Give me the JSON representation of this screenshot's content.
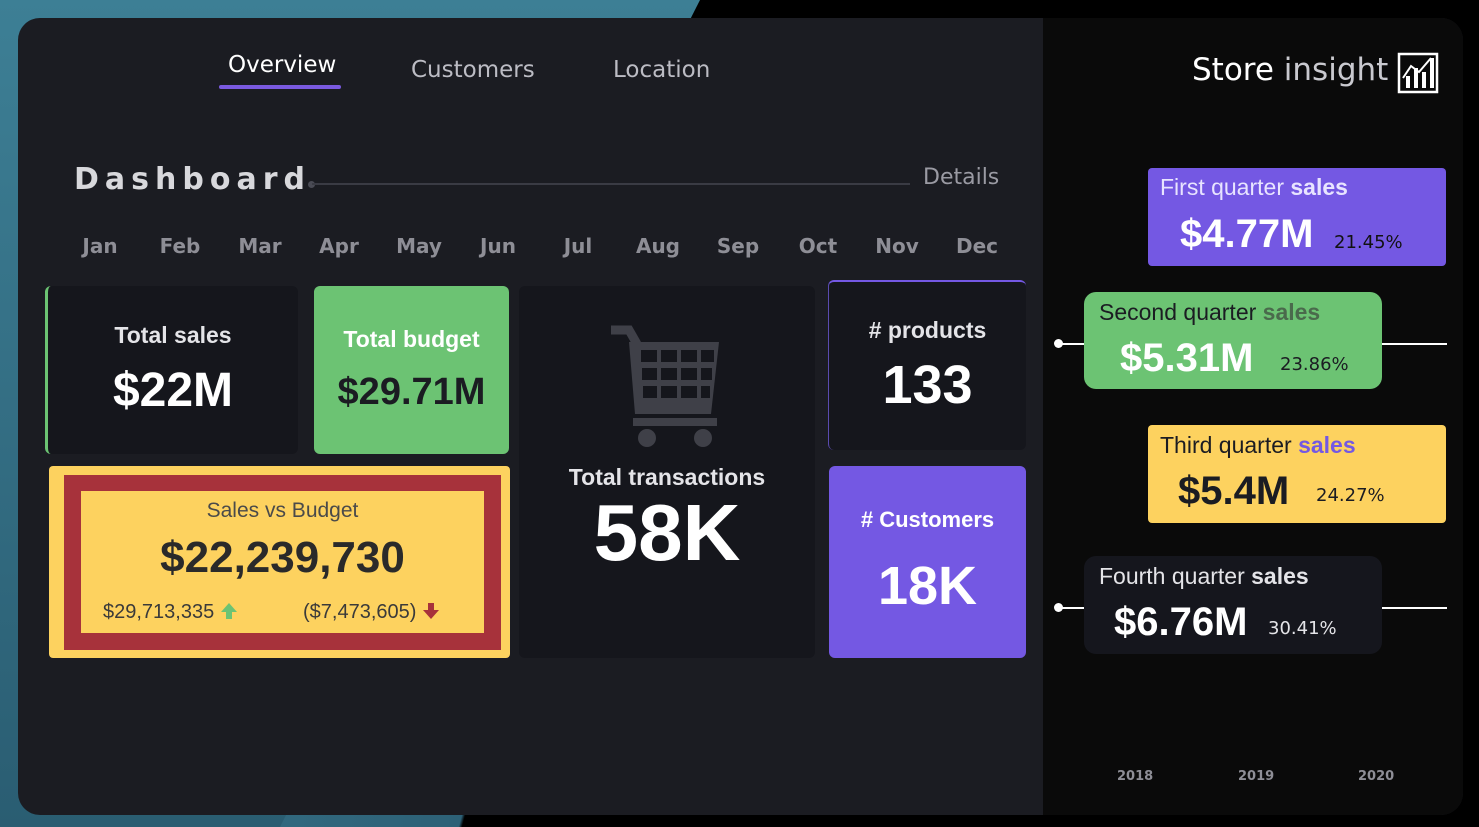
{
  "nav": {
    "tabs": [
      {
        "label": "Overview"
      },
      {
        "label": "Customers"
      },
      {
        "label": "Location"
      }
    ]
  },
  "brand": {
    "title_bold": "Store",
    "title_light": "insight",
    "icon": "bar-chart-icon"
  },
  "dashboard": {
    "title": "Dashboard",
    "details_link": "Details"
  },
  "months": [
    "Jan",
    "Feb",
    "Mar",
    "Apr",
    "May",
    "Jun",
    "Jul",
    "Aug",
    "Sep",
    "Oct",
    "Nov",
    "Dec"
  ],
  "kpis": {
    "total_sales": {
      "label": "Total sales",
      "value": "$22M"
    },
    "total_budget": {
      "label": "Total budget",
      "value": "$29.71M"
    },
    "total_transactions": {
      "label": "Total transactions",
      "value": "58K",
      "icon": "shopping-cart-icon"
    },
    "products": {
      "label": "# products",
      "value": "133"
    },
    "customers": {
      "label": "# Customers",
      "value": "18K"
    }
  },
  "sales_vs_budget": {
    "title": "Sales vs Budget",
    "value": "$22,239,730",
    "budget": "$29,713,335",
    "variance": "($7,473,605)"
  },
  "quarters": [
    {
      "label_a": "First quarter",
      "label_b": "sales",
      "value": "$4.77M",
      "pct": "21.45%",
      "color": "#7458e3"
    },
    {
      "label_a": "Second quarter",
      "label_b": "sales",
      "value": "$5.31M",
      "pct": "23.86%",
      "color": "#6cc373"
    },
    {
      "label_a": "Third quarter",
      "label_b": "sales",
      "value": "$5.4M",
      "pct": "24.27%",
      "color": "#fdd25f"
    },
    {
      "label_a": "Fourth quarter",
      "label_b": "sales",
      "value": "$6.76M",
      "pct": "30.41%",
      "color": "#15161d"
    }
  ],
  "years": [
    "2018",
    "2019",
    "2020"
  ],
  "colors": {
    "accent": "#7a5ae0",
    "green": "#6cc373",
    "yellow": "#fdd25f",
    "red": "#a7323b",
    "purple": "#7458e3"
  }
}
